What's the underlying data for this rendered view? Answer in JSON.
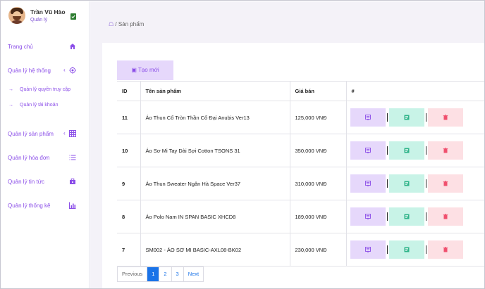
{
  "profile": {
    "name": "Trần Vũ Hào",
    "role": "Quản lý"
  },
  "nav": {
    "home": "Trang chủ",
    "systems": "Quản lý hệ thống",
    "sub_access": "Quản lý quyền truy cập",
    "sub_accounts": "Quản lý tài khoản",
    "products": "Quản lý sản phẩm",
    "orders": "Quản lý hóa đơn",
    "news": "Quản lý tin tức",
    "stats": "Quản lý thống kê"
  },
  "breadcrumb": {
    "separator": "/",
    "current": "Sản phẩm"
  },
  "toolbar": {
    "create_label": "Tạo mới"
  },
  "table": {
    "headers": [
      "ID",
      "Tên sản phẩm",
      "Giá bán",
      "#"
    ],
    "rows": [
      {
        "id": "11",
        "name": "Áo Thun Cổ Tròn Thần Cổ Đại Anubis Ver13",
        "price": "125,000 VNĐ"
      },
      {
        "id": "10",
        "name": "Áo Sơ Mi Tay Dài Sợi Cotton TSONS 31",
        "price": "350,000 VNĐ"
      },
      {
        "id": "9",
        "name": "Áo Thun Sweater Ngân Hà Space Ver37",
        "price": "310,000 VNĐ"
      },
      {
        "id": "8",
        "name": "Áo Polo Nam IN SPAN BASIC XHCD8",
        "price": "189,000 VNĐ"
      },
      {
        "id": "7",
        "name": "SM002 - ÁO SƠ MI BASIC-AXL08-BK02",
        "price": "230,000 VNĐ"
      }
    ]
  },
  "pagination": {
    "prev": "Previous",
    "pages": [
      "1",
      "2",
      "3"
    ],
    "active": "1",
    "next": "Next"
  },
  "colors": {
    "accent": "#8b4ee8",
    "view": "#e6d8fb",
    "edit": "#c8f3e7",
    "delete": "#fde0e4",
    "page_active": "#1a73e8"
  },
  "icons": {
    "nav": [
      "home-icon",
      "settings-icon",
      "grid-icon",
      "list-icon",
      "newspaper-icon",
      "bar-chart-icon"
    ],
    "actions": [
      "view-icon",
      "edit-icon",
      "trash-icon"
    ]
  }
}
